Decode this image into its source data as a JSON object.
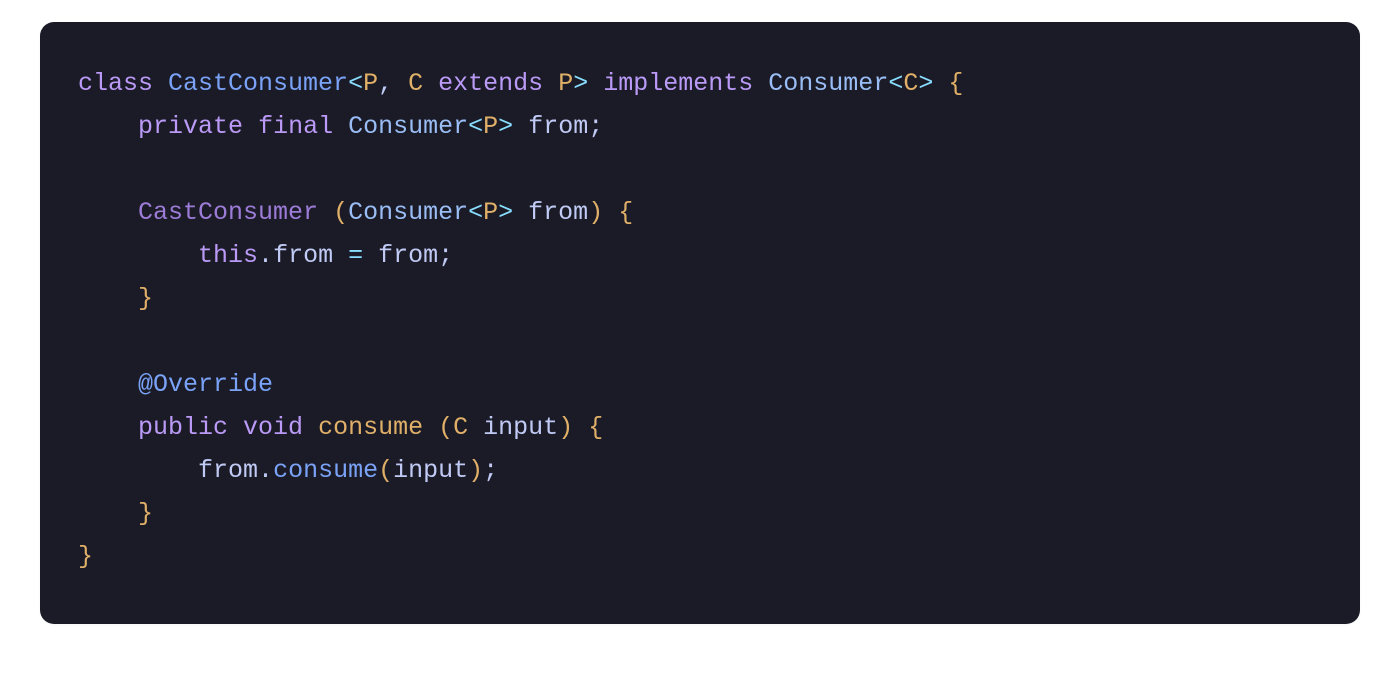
{
  "code": {
    "l1": {
      "kw_class": "class",
      "cls_name": "CastConsumer",
      "lt1": "<",
      "gen_p": "P",
      "comma": ",",
      "gen_c": "C",
      "kw_extends": "extends",
      "gen_p2": "P",
      "gt1": ">",
      "kw_implements": "implements",
      "iface": "Consumer",
      "lt2": "<",
      "gen_c2": "C",
      "gt2": ">",
      "brace_open": "{"
    },
    "l2": {
      "kw_private": "private",
      "kw_final": "final",
      "type": "Consumer",
      "lt": "<",
      "gen_p": "P",
      "gt": ">",
      "name": "from",
      "semi": ";"
    },
    "l4": {
      "ctor": "CastConsumer",
      "paren_open": "(",
      "type": "Consumer",
      "lt": "<",
      "gen_p": "P",
      "gt": ">",
      "param": "from",
      "paren_close": ")",
      "brace_open": "{"
    },
    "l5": {
      "this": "this",
      "dot": ".",
      "field": "from",
      "eq": "=",
      "rhs": "from",
      "semi": ";"
    },
    "l6": {
      "brace_close": "}"
    },
    "l8": {
      "at": "@",
      "anno": "Override"
    },
    "l9": {
      "kw_public": "public",
      "kw_void": "void",
      "fn": "consume",
      "paren_open": "(",
      "ptype": "C",
      "pname": "input",
      "paren_close": ")",
      "brace_open": "{"
    },
    "l10": {
      "obj": "from",
      "dot": ".",
      "call": "consume",
      "paren_open": "(",
      "arg": "input",
      "paren_close": ")",
      "semi": ";"
    },
    "l11": {
      "brace_close": "}"
    },
    "l12": {
      "brace_close": "}"
    }
  }
}
